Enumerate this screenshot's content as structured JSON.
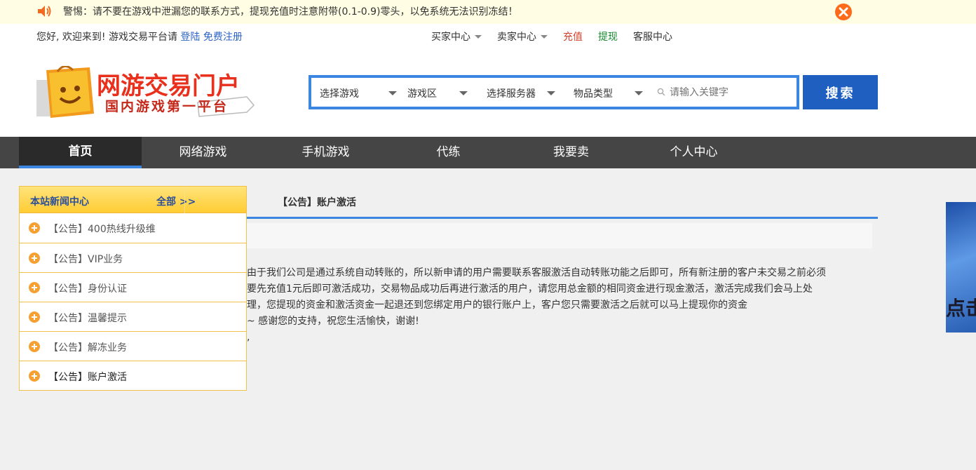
{
  "warning": {
    "text": "警惕：请不要在游戏中泄漏您的联系方式，提现充值时注意附带(0.1-0.9)零头，以免系统无法识别冻结！"
  },
  "topbar": {
    "welcome": "您好, 欢迎来到!  游戏交易平台请",
    "login": "登陆",
    "register": "免费注册",
    "menu": [
      "买家中心",
      "卖家中心",
      "充值",
      "提现",
      "客服中心"
    ]
  },
  "logo": {
    "line1": "网游交易门户",
    "line2": "国内游戏第一平台"
  },
  "search": {
    "game": "选择游戏",
    "zone": "游戏区",
    "server": "选择服务器",
    "type": "物品类型",
    "placeholder": "请输入关键字",
    "button": "搜索"
  },
  "nav": [
    "首页",
    "网络游戏",
    "手机游戏",
    "代练",
    "我要卖",
    "个人中心"
  ],
  "news": {
    "title": "本站新闻中心",
    "all": "全部 >>",
    "items": [
      "【公告】400热线升级维",
      "【公告】VIP业务",
      "【公告】身份认证",
      "【公告】温馨提示",
      "【公告】解冻业务",
      "【公告】账户激活"
    ]
  },
  "article": {
    "title": "【公告】账户激活",
    "lines": [
      "由于我们公司是通过系统自动转账的，所以新申请的用户需要联系客服激活自动转账功能之后即可，所有新注册的客户未交易之前必须",
      "要先充值1元后即可激活成功，交易物品成功后再进行激活的用户，请您用总金额的相同资金进行现金激活，激活完成我们会马上处",
      "理，您提现的资金和激活资金一起退还到您绑定用户的银行账户上，客户您只需要激活之后就可以马上提现你的资金",
      "~  感谢您的支持，祝您生活愉快，谢谢!",
      ","
    ]
  },
  "ad": {
    "text": "点击"
  },
  "colors": {
    "accent": "#3a86e0",
    "search_button": "#1e5fbf",
    "nav_bg": "#454545",
    "warn_bg": "#fffde3",
    "close": "#ff6a1a",
    "news_border": "#f2c14a"
  }
}
